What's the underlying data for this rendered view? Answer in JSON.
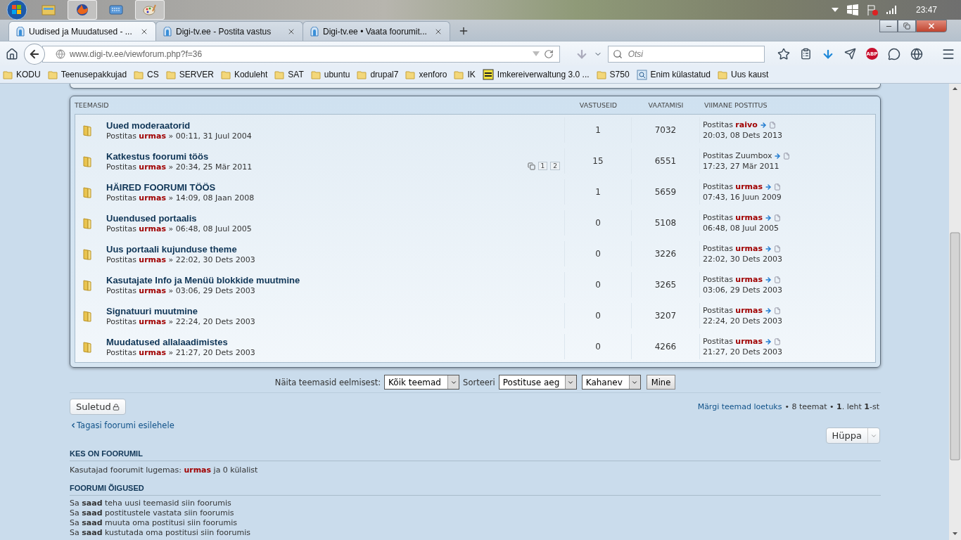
{
  "taskbar": {
    "apps": [
      {
        "kind": "explorer",
        "running": false
      },
      {
        "kind": "firefox",
        "running": true
      },
      {
        "kind": "keyboard",
        "running": false
      },
      {
        "kind": "paint",
        "running": true
      }
    ],
    "clock": "23:47"
  },
  "browser": {
    "tabs": [
      {
        "title": "Uudised ja Muudatused - ...",
        "selected": true
      },
      {
        "title": "Digi-tv.ee - Postita vastus",
        "selected": false
      },
      {
        "title": "Digi-tv.ee • Vaata foorumit...",
        "selected": false
      }
    ],
    "url": "www.digi-tv.ee/viewforum.php?f=36",
    "search_placeholder": "Otsi",
    "adblock_label": "ABP",
    "bookmarks": [
      {
        "label": "KODU",
        "kind": "folder"
      },
      {
        "label": "Teenusepakkujad",
        "kind": "folder"
      },
      {
        "label": "CS",
        "kind": "folder"
      },
      {
        "label": "SERVER",
        "kind": "folder"
      },
      {
        "label": "Koduleht",
        "kind": "folder"
      },
      {
        "label": "SAT",
        "kind": "folder"
      },
      {
        "label": "ubuntu",
        "kind": "folder"
      },
      {
        "label": "drupal7",
        "kind": "folder"
      },
      {
        "label": "xenforo",
        "kind": "folder"
      },
      {
        "label": "IK",
        "kind": "folder"
      },
      {
        "label": "Imkereiverwaltung 3.0 ...",
        "kind": "site"
      },
      {
        "label": "S750",
        "kind": "folder"
      },
      {
        "label": "Enim külastatud",
        "kind": "smart"
      },
      {
        "label": "Uus kaust",
        "kind": "folder"
      }
    ]
  },
  "topics": {
    "columns": [
      "TEEMASID",
      "VASTUSEID",
      "VAATAMISI",
      "VIIMANE POSTITUS"
    ],
    "rows": [
      {
        "title": "Uued moderaatorid",
        "posted_by": "Postitas",
        "author": "urmas",
        "date": "» 00:11, 31 Juul 2004",
        "replies": "1",
        "views": "7032",
        "last_posted_by": "Postitas",
        "last_author": "raivo",
        "last_author_highlighted": true,
        "last_date": "20:03, 08 Dets 2013"
      },
      {
        "title": "Katkestus foorumi töös",
        "posted_by": "Postitas",
        "author": "urmas",
        "date": "» 20:34, 25 Mär 2011",
        "pages": [
          "1",
          "2"
        ],
        "replies": "15",
        "views": "6551",
        "last_posted_by": "Postitas",
        "last_author": "Zuumbox",
        "last_author_highlighted": false,
        "last_date": "17:23, 27 Mär 2011"
      },
      {
        "title": "HÄIRED FOORUMI TÖÖS",
        "posted_by": "Postitas",
        "author": "urmas",
        "date": "» 14:09, 08 Jaan 2008",
        "replies": "1",
        "views": "5659",
        "last_posted_by": "Postitas",
        "last_author": "urmas",
        "last_author_highlighted": true,
        "last_date": "07:43, 16 Juun 2009"
      },
      {
        "title": "Uuendused portaalis",
        "posted_by": "Postitas",
        "author": "urmas",
        "date": "» 06:48, 08 Juul 2005",
        "replies": "0",
        "views": "5108",
        "last_posted_by": "Postitas",
        "last_author": "urmas",
        "last_author_highlighted": true,
        "last_date": "06:48, 08 Juul 2005"
      },
      {
        "title": "Uus portaali kujunduse theme",
        "posted_by": "Postitas",
        "author": "urmas",
        "date": "» 22:02, 30 Dets 2003",
        "replies": "0",
        "views": "3226",
        "last_posted_by": "Postitas",
        "last_author": "urmas",
        "last_author_highlighted": true,
        "last_date": "22:02, 30 Dets 2003"
      },
      {
        "title": "Kasutajate Info ja Menüü blokkide muutmine",
        "posted_by": "Postitas",
        "author": "urmas",
        "date": "» 03:06, 29 Dets 2003",
        "replies": "0",
        "views": "3265",
        "last_posted_by": "Postitas",
        "last_author": "urmas",
        "last_author_highlighted": true,
        "last_date": "03:06, 29 Dets 2003"
      },
      {
        "title": "Signatuuri muutmine",
        "posted_by": "Postitas",
        "author": "urmas",
        "date": "» 22:24, 20 Dets 2003",
        "replies": "0",
        "views": "3207",
        "last_posted_by": "Postitas",
        "last_author": "urmas",
        "last_author_highlighted": true,
        "last_date": "22:24, 20 Dets 2003"
      },
      {
        "title": "Muudatused allalaadimistes",
        "posted_by": "Postitas",
        "author": "urmas",
        "date": "» 21:27, 20 Dets 2003",
        "replies": "0",
        "views": "4266",
        "last_posted_by": "Postitas",
        "last_author": "urmas",
        "last_author_highlighted": true,
        "last_date": "21:27, 20 Dets 2003"
      }
    ]
  },
  "filter": {
    "show_label": "Näita teemasid eelmisest:",
    "show_value": "Kõik teemad",
    "sort_label": "Sorteeri",
    "sort_value": "Postituse aeg",
    "order_value": "Kahanev",
    "go_button": "Mine"
  },
  "locked_button": "Suletud",
  "mark_read_link": "Märgi teemad loetuks",
  "summary": "• 8 teemat • **1**. leht **1**-st",
  "back_link": "Tagasi foorumi esilehele",
  "jump_button": "Hüppa",
  "online": {
    "heading": "KES ON FOORUMIL",
    "prefix": "Kasutajad foorumit lugemas:",
    "user": "urmas",
    "suffix": "ja 0 külalist"
  },
  "permissions": {
    "heading": "FOORUMI ÕIGUSED",
    "items": [
      "Sa **saad** teha uusi teemasid siin foorumis",
      "Sa **saad** postitustele vastata siin foorumis",
      "Sa **saad** muuta oma postitusi siin foorumis",
      "Sa **saad** kustutada oma postitusi siin foorumis"
    ]
  }
}
